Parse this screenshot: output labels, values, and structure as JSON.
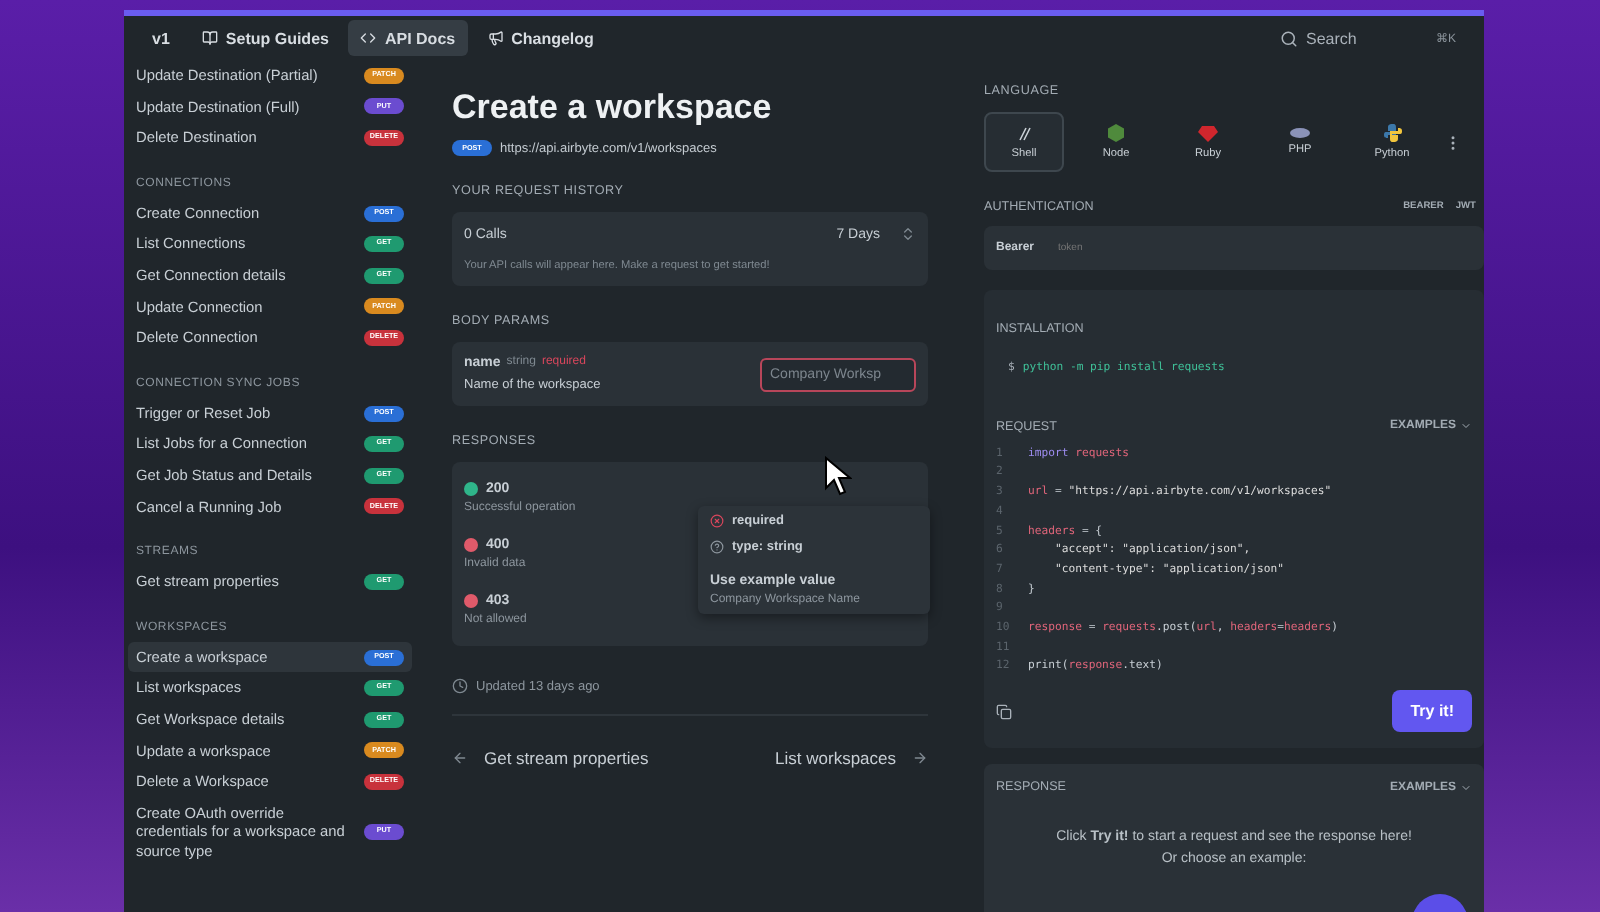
{
  "topbar": {
    "version": "v1",
    "tabs": [
      {
        "label": "Setup Guides",
        "selected": false
      },
      {
        "label": "API Docs",
        "selected": true
      },
      {
        "label": "Changelog",
        "selected": false
      }
    ],
    "search": {
      "placeholder": "Search",
      "shortcut": "⌘K"
    }
  },
  "sidebar": {
    "sections": [
      {
        "items": [
          {
            "label": "Update Destination (Partial)",
            "method": "PATCH",
            "selected": false
          },
          {
            "label": "Update Destination (Full)",
            "method": "PUT",
            "selected": false
          },
          {
            "label": "Delete Destination",
            "method": "DELETE",
            "selected": false
          }
        ]
      },
      {
        "title": "CONNECTIONS",
        "items": [
          {
            "label": "Create Connection",
            "method": "POST",
            "selected": false
          },
          {
            "label": "List Connections",
            "method": "GET",
            "selected": false
          },
          {
            "label": "Get Connection details",
            "method": "GET",
            "selected": false
          },
          {
            "label": "Update Connection",
            "method": "PATCH",
            "selected": false
          },
          {
            "label": "Delete Connection",
            "method": "DELETE",
            "selected": false
          }
        ]
      },
      {
        "title": "CONNECTION SYNC JOBS",
        "items": [
          {
            "label": "Trigger or Reset Job",
            "method": "POST",
            "selected": false
          },
          {
            "label": "List Jobs for a Connection",
            "method": "GET",
            "selected": false
          },
          {
            "label": "Get Job Status and Details",
            "method": "GET",
            "selected": false
          },
          {
            "label": "Cancel a Running Job",
            "method": "DELETE",
            "selected": false
          }
        ]
      },
      {
        "title": "STREAMS",
        "items": [
          {
            "label": "Get stream properties",
            "method": "GET",
            "selected": false
          }
        ]
      },
      {
        "title": "WORKSPACES",
        "items": [
          {
            "label": "Create a workspace",
            "method": "POST",
            "selected": true
          },
          {
            "label": "List workspaces",
            "method": "GET",
            "selected": false
          },
          {
            "label": "Get Workspace details",
            "method": "GET",
            "selected": false
          },
          {
            "label": "Update a workspace",
            "method": "PATCH",
            "selected": false
          },
          {
            "label": "Delete a Workspace",
            "method": "DELETE",
            "selected": false
          },
          {
            "label": "Create OAuth override credentials for a workspace and source type",
            "method": "PUT",
            "selected": false
          }
        ]
      }
    ]
  },
  "page": {
    "title": "Create a workspace",
    "method": "POST",
    "url": "https://api.airbyte.com/v1/workspaces",
    "history": {
      "heading": "YOUR REQUEST HISTORY",
      "calls": "0 Calls",
      "range": "7 Days",
      "empty": "Your API calls will appear here. Make a request to get started!"
    },
    "body_params": {
      "heading": "BODY PARAMS",
      "name": "name",
      "type": "string",
      "required": "required",
      "description": "Name of the workspace",
      "placeholder": "Company Worksp"
    },
    "popover": {
      "items": [
        "required",
        "type: string"
      ],
      "example_title": "Use example value",
      "example_value": "Company Workspace Name"
    },
    "responses": {
      "heading": "RESPONSES",
      "items": [
        {
          "code": "200",
          "text": "Successful operation",
          "color": "#2fb58a"
        },
        {
          "code": "400",
          "text": "Invalid data",
          "color": "#e05a6a"
        },
        {
          "code": "403",
          "text": "Not allowed",
          "color": "#e05a6a"
        }
      ]
    },
    "updated": "Updated 13 days ago",
    "prev": "Get stream properties",
    "next": "List workspaces"
  },
  "right": {
    "language_heading": "LANGUAGE",
    "languages": [
      {
        "label": "Shell",
        "selected": true
      },
      {
        "label": "Node",
        "selected": false
      },
      {
        "label": "Ruby",
        "selected": false
      },
      {
        "label": "PHP",
        "selected": false
      },
      {
        "label": "Python",
        "selected": false
      }
    ],
    "auth_heading": "AUTHENTICATION",
    "auth_options": [
      "BEARER",
      "JWT"
    ],
    "auth_label": "Bearer",
    "auth_placeholder": "token",
    "install_heading": "INSTALLATION",
    "install_prompt": "$",
    "install_command": "python -m pip install requests",
    "request_heading": "REQUEST",
    "examples": "EXAMPLES",
    "code": [
      {
        "number": "1",
        "tokens": [
          {
            "text": "import",
            "kind": "keyword"
          },
          {
            "text": " requests",
            "kind": "name"
          }
        ]
      },
      {
        "number": "2"
      },
      {
        "number": "3",
        "tokens": [
          {
            "text": "url",
            "kind": "name"
          },
          {
            "text": " = ",
            "kind": "plain"
          },
          {
            "text": "\"https://api.airbyte.com/v1/workspaces\"",
            "kind": "string"
          }
        ]
      },
      {
        "number": "4"
      },
      {
        "number": "5",
        "tokens": [
          {
            "text": "headers",
            "kind": "name"
          },
          {
            "text": " = {",
            "kind": "plain"
          }
        ]
      },
      {
        "number": "6",
        "tokens": [
          {
            "text": "    \"accept\": \"application/json\",",
            "kind": "string"
          }
        ]
      },
      {
        "number": "7",
        "tokens": [
          {
            "text": "    \"content-type\": \"application/json\"",
            "kind": "string"
          }
        ]
      },
      {
        "number": "8",
        "tokens": [
          {
            "text": "}",
            "kind": "plain"
          }
        ]
      },
      {
        "number": "9"
      },
      {
        "number": "10",
        "tokens": [
          {
            "text": "response",
            "kind": "name"
          },
          {
            "text": " = ",
            "kind": "plain"
          },
          {
            "text": "requests",
            "kind": "name"
          },
          {
            "text": ".post(",
            "kind": "plain"
          },
          {
            "text": "url",
            "kind": "name"
          },
          {
            "text": ", ",
            "kind": "plain"
          },
          {
            "text": "headers",
            "kind": "name"
          },
          {
            "text": "=",
            "kind": "plain"
          },
          {
            "text": "headers",
            "kind": "name"
          },
          {
            "text": ")",
            "kind": "plain"
          }
        ]
      },
      {
        "number": "11"
      },
      {
        "number": "12",
        "tokens": [
          {
            "text": "print(",
            "kind": "plain"
          },
          {
            "text": "response",
            "kind": "name"
          },
          {
            "text": ".text)",
            "kind": "plain"
          }
        ]
      }
    ],
    "try_button": "Try it!",
    "response_heading": "RESPONSE",
    "response_examples": "EXAMPLES",
    "response_text": "Click **Try it!** to start a request and see the response here!",
    "response_text2": "Or choose an example:"
  }
}
